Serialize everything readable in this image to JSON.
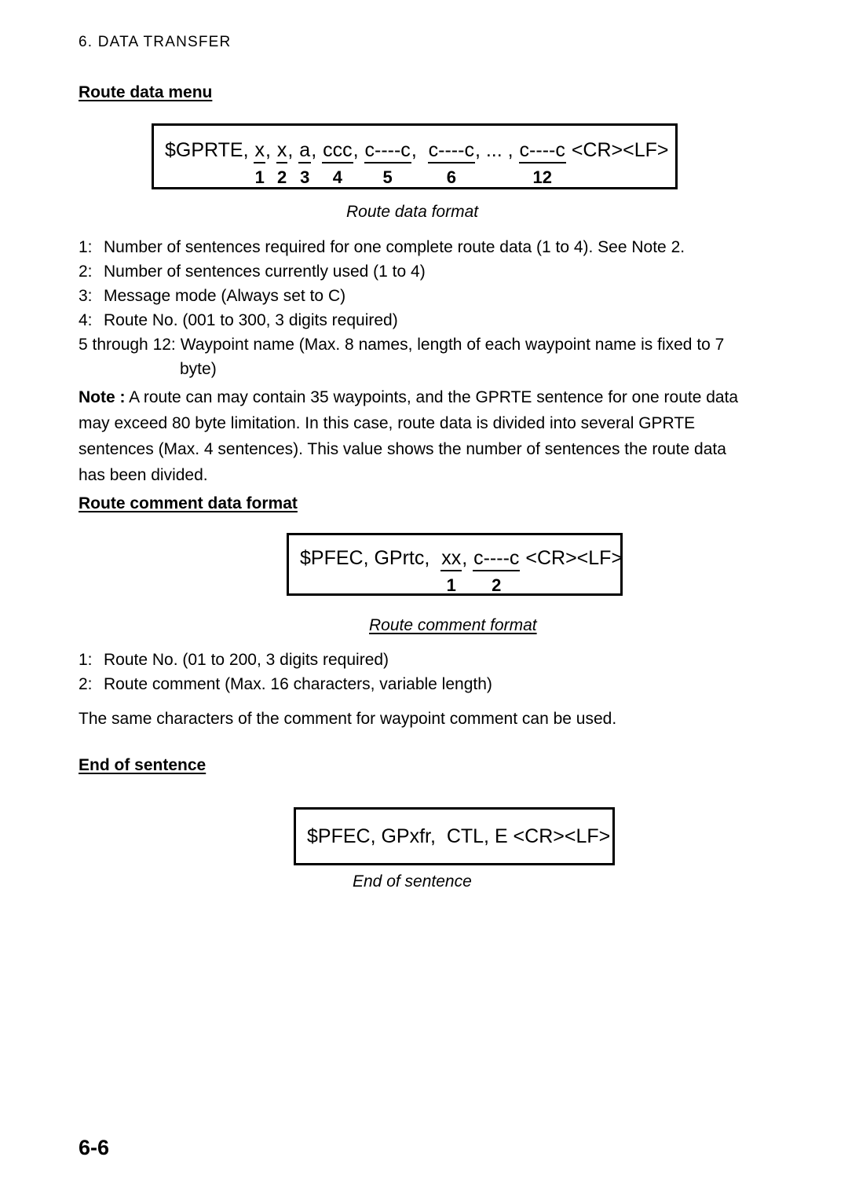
{
  "header": {
    "running_title": "6. DATA TRANSFER"
  },
  "sections": {
    "route_data_menu": {
      "heading": "Route data menu",
      "caption": "Route data format",
      "sentence": {
        "prefix": "$GPRTE, ",
        "fields": [
          {
            "token": "x",
            "index": "1",
            "separator": ", "
          },
          {
            "token": "x",
            "index": "2",
            "separator": ", "
          },
          {
            "token": "a",
            "index": "3",
            "separator": ", "
          },
          {
            "token": "ccc",
            "index": "4",
            "separator": ", "
          },
          {
            "token": "c----c",
            "index": "5",
            "separator": ",  "
          },
          {
            "token": "c----c",
            "index": "6",
            "separator": ", ... , "
          },
          {
            "token": "c----c",
            "index": "12",
            "separator": " "
          }
        ],
        "suffix": "<CR><LF>"
      },
      "definitions": [
        {
          "num": "1:",
          "text": "Number of sentences required for one complete route data (1 to 4). See Note 2."
        },
        {
          "num": "2:",
          "text": "Number of sentences currently used (1 to 4)"
        },
        {
          "num": "3:",
          "text": "Message mode (Always set to C)"
        },
        {
          "num": "4:",
          "text": "Route No. (001 to 300, 3 digits required)"
        }
      ],
      "definition_wide": {
        "num": "5 through 12:",
        "text": "Waypoint name (Max. 8 names, length of each waypoint name is fixed to 7",
        "continuation": "byte)"
      }
    },
    "note": {
      "label": "Note :",
      "text": " A route can may contain 35 waypoints, and the GPRTE sentence for one route data may exceed 80 byte limitation. In this case, route data is divided into several GPRTE sentences (Max. 4 sentences). This value shows the number of sentences the route data has been divided."
    },
    "route_comment_data_format": {
      "heading": "Route comment data format",
      "caption": "Route comment format",
      "sentence": {
        "prefix": "$PFEC, GPrtc,  ",
        "fields": [
          {
            "token": "xx",
            "index": "1",
            "separator": ", "
          },
          {
            "token": "c----c",
            "index": "2",
            "separator": " "
          }
        ],
        "suffix": "<CR><LF>"
      },
      "definitions": [
        {
          "num": "1:",
          "text": "Route No. (01 to 200, 3 digits required)"
        },
        {
          "num": "2:",
          "text": "Route comment (Max. 16 characters, variable length)"
        }
      ],
      "remark": "The same characters of the comment for waypoint comment can be used."
    },
    "end_of_sentence": {
      "heading": "End of sentence",
      "caption": "End of sentence",
      "sentence": {
        "text": "$PFEC, GPxfr,  CTL, E <CR><LF>"
      }
    }
  },
  "footer": {
    "page_number": "6-6"
  }
}
